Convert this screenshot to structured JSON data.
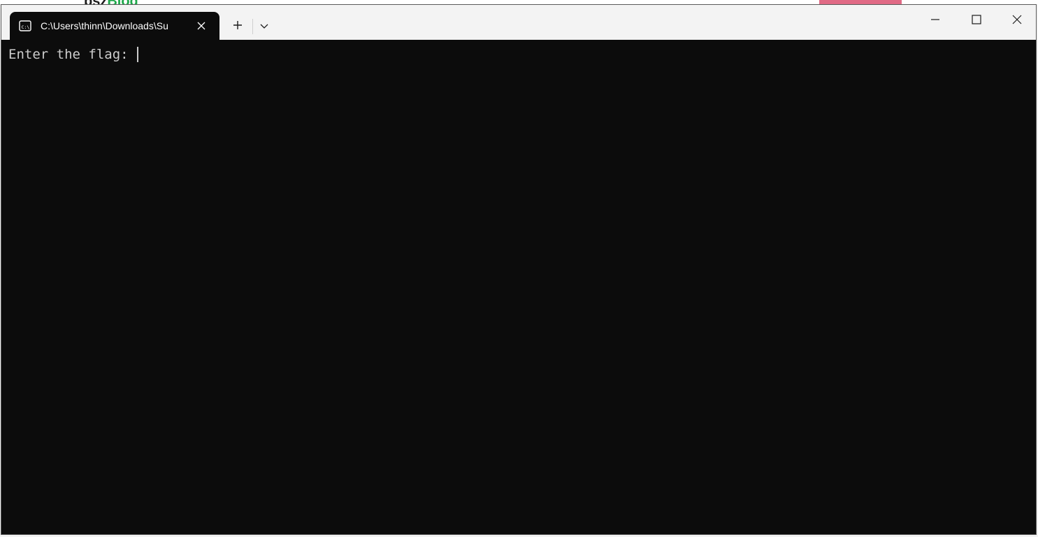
{
  "background": {
    "logo_text": "bsz",
    "logo_accent": "Blog"
  },
  "tab": {
    "title": "C:\\Users\\thinn\\Downloads\\Su",
    "icon": "console-icon"
  },
  "titlebar": {
    "new_tab_icon": "plus-icon",
    "dropdown_icon": "chevron-down-icon",
    "minimize_icon": "minimize-icon",
    "maximize_icon": "maximize-icon",
    "close_icon": "close-icon"
  },
  "terminal": {
    "prompt": "Enter the flag: ",
    "input_value": ""
  },
  "colors": {
    "terminal_bg": "#0c0c0c",
    "terminal_fg": "#cccccc",
    "titlebar_bg": "#f3f3f3"
  }
}
